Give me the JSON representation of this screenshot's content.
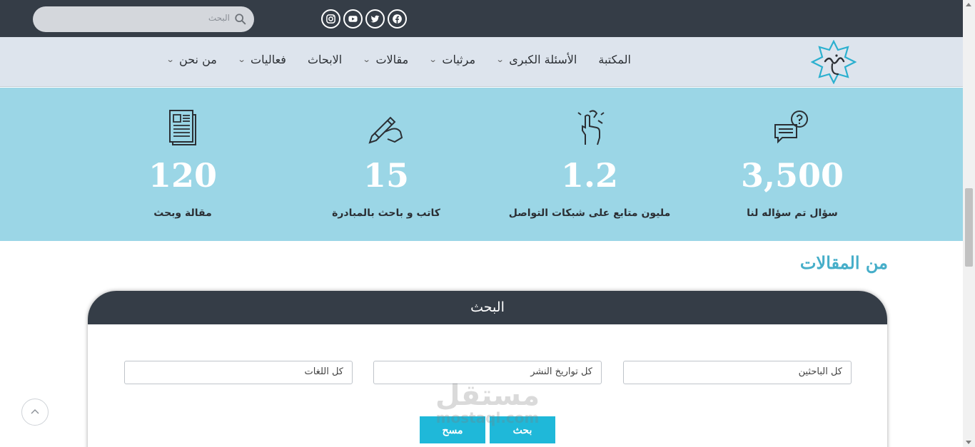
{
  "topbar": {
    "search": {
      "placeholder": "البحث",
      "icon": "search-icon"
    },
    "socials": [
      {
        "name": "instagram-icon"
      },
      {
        "name": "youtube-icon"
      },
      {
        "name": "twitter-icon"
      },
      {
        "name": "facebook-icon"
      }
    ]
  },
  "nav": {
    "items": [
      {
        "label": "من نحن",
        "has_dropdown": true
      },
      {
        "label": "فعاليات",
        "has_dropdown": true
      },
      {
        "label": "الابحاث",
        "has_dropdown": false
      },
      {
        "label": "مقالات",
        "has_dropdown": true
      },
      {
        "label": "مرثيات",
        "has_dropdown": true
      },
      {
        "label": "الأسئلة الكبرى",
        "has_dropdown": true
      },
      {
        "label": "المكتبة",
        "has_dropdown": false
      }
    ],
    "chevron": "⌄"
  },
  "stats": [
    {
      "icon": "question-chat-icon",
      "number": "3,500",
      "caption": "سؤال تم سؤاله لنا"
    },
    {
      "icon": "hand-pointer-icon",
      "number": "1.2",
      "caption": "مليون متابع على شبكات التواصل"
    },
    {
      "icon": "hand-pen-icon",
      "number": "15",
      "caption": "كاتب و باحث بالمبادرة"
    },
    {
      "icon": "newspaper-icon",
      "number": "120",
      "caption": "مقالة وبحث"
    }
  ],
  "section": {
    "title": "من المقالات"
  },
  "search_card": {
    "title": "البحث",
    "filters": {
      "researchers": "كل الباحثين",
      "dates": "كل تواريخ النشر",
      "languages": "كل اللغات"
    },
    "search_button": "بحث",
    "clear_button": "مسح"
  },
  "watermark": {
    "arabic": "مستقل",
    "latin": "mostaql.com"
  },
  "colors": {
    "topbar": "#353d47",
    "nav": "#dde4ed",
    "stats_band": "#9bd6e6",
    "accent": "#1fb8d9",
    "section_title": "#46aec9"
  }
}
